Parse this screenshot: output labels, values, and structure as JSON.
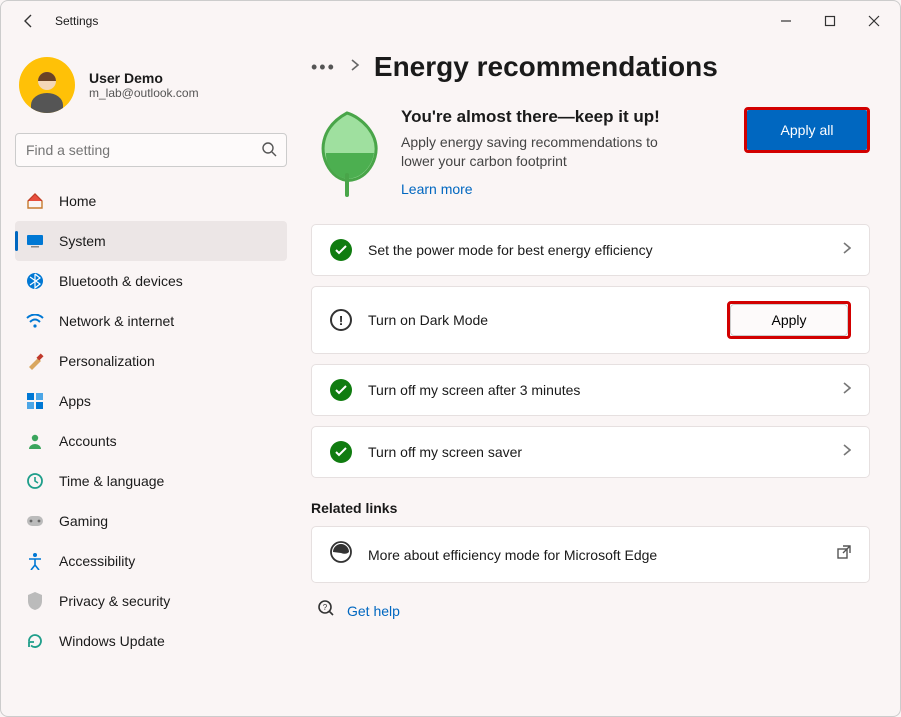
{
  "window": {
    "title": "Settings"
  },
  "user": {
    "name": "User Demo",
    "email": "m_lab@outlook.com"
  },
  "search": {
    "placeholder": "Find a setting"
  },
  "nav": {
    "home": "Home",
    "system": "System",
    "bluetooth": "Bluetooth & devices",
    "network": "Network & internet",
    "personalization": "Personalization",
    "apps": "Apps",
    "accounts": "Accounts",
    "time": "Time & language",
    "gaming": "Gaming",
    "accessibility": "Accessibility",
    "privacy": "Privacy & security",
    "update": "Windows Update"
  },
  "page": {
    "title": "Energy recommendations",
    "hero_title": "You're almost there—keep it up!",
    "hero_body": "Apply energy saving recommendations to lower your carbon footprint",
    "learn_more": "Learn more",
    "apply_all": "Apply all"
  },
  "cards": {
    "power_mode": "Set the power mode for best energy efficiency",
    "dark_mode": "Turn on Dark Mode",
    "screen_off": "Turn off my screen after 3 minutes",
    "screen_saver": "Turn off my screen saver",
    "apply": "Apply"
  },
  "related": {
    "heading": "Related links",
    "edge": "More about efficiency mode for Microsoft Edge"
  },
  "help": {
    "label": "Get help"
  }
}
